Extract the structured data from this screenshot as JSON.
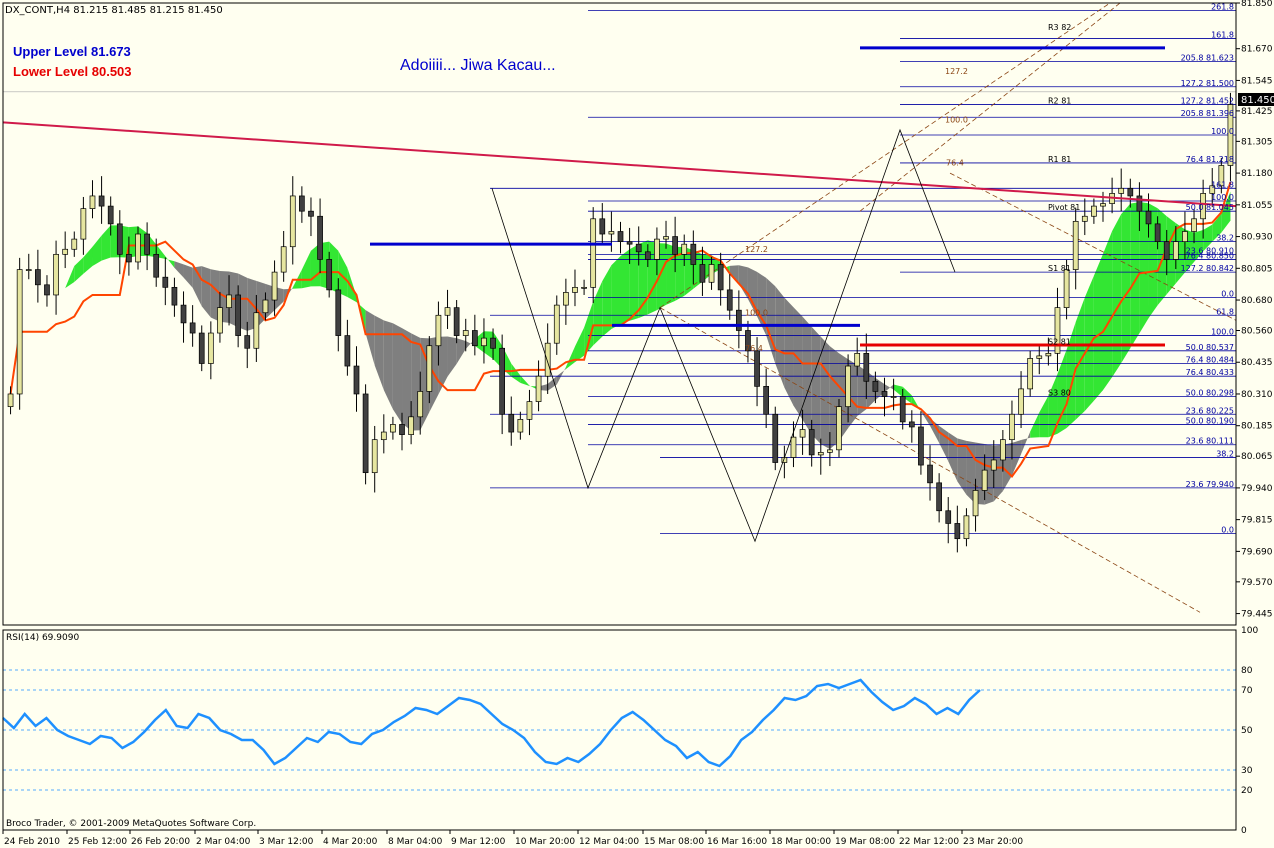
{
  "window": {
    "header": "DX_CONT,H4  81.215 81.485 81.215 81.450",
    "upper_level": "Upper Level 81.673",
    "lower_level": "Lower Level 80.503",
    "annotation": "Adoiiii... Jiwa Kacau...",
    "current_price": "81.450",
    "copyright": "Broco Trader, © 2001-2009 MetaQuotes Software Corp."
  },
  "colors": {
    "background": "#fffff0",
    "grid": "#7f7f7f",
    "bull_candle": "#e6e6a0",
    "bear_candle": "#404040",
    "cloud_bull": "#33e633",
    "cloud_bear": "#7f7f7f",
    "kijun": "#ff4500",
    "trendline": "#d01a4a",
    "fib_lines": "#0000a0",
    "channel": "#8b4513",
    "rsi_line": "#1e90ff",
    "level_blue": "#0000cd",
    "level_red": "#e60000"
  },
  "chart_data": [
    {
      "type": "candlestick",
      "title": "DX_CONT,H4  81.215 81.485 81.215 81.450",
      "ylim": [
        79.4,
        81.85
      ],
      "y_ticks": [
        "81.850",
        "81.670",
        "81.545",
        "81.425",
        "81.305",
        "81.180",
        "81.055",
        "80.930",
        "80.805",
        "80.680",
        "80.560",
        "80.435",
        "80.310",
        "80.185",
        "80.065",
        "79.940",
        "79.815",
        "79.690",
        "79.570",
        "79.445"
      ],
      "x_ticks": [
        "24 Feb 2010",
        "25 Feb 12:00",
        "26 Feb 20:00",
        "2 Mar 04:00",
        "3 Mar 12:00",
        "4 Mar 20:00",
        "8 Mar 04:00",
        "9 Mar 12:00",
        "10 Mar 20:00",
        "12 Mar 04:00",
        "15 Mar 08:00",
        "16 Mar 16:00",
        "18 Mar 00:00",
        "19 Mar 08:00",
        "22 Mar 12:00",
        "23 Mar 20:00"
      ],
      "close": [
        80.31,
        80.8,
        80.8,
        80.74,
        80.7,
        80.86,
        80.88,
        80.92,
        81.04,
        81.09,
        81.05,
        80.98,
        80.86,
        80.83,
        80.94,
        80.86,
        80.77,
        80.73,
        80.66,
        80.59,
        80.55,
        80.43,
        80.55,
        80.65,
        80.7,
        80.54,
        80.49,
        80.63,
        80.68,
        80.79,
        80.89,
        81.09,
        81.03,
        81.01,
        80.84,
        80.72,
        80.54,
        80.42,
        80.31,
        80.0,
        80.13,
        80.16,
        80.19,
        80.15,
        80.22,
        80.32,
        80.5,
        80.62,
        80.65,
        80.54,
        80.56,
        80.5,
        80.53,
        80.49,
        80.23,
        80.16,
        80.21,
        80.28,
        80.38,
        80.51,
        80.66,
        80.71,
        80.73,
        80.73,
        81.0,
        80.94,
        80.95,
        80.91,
        80.9,
        80.87,
        80.84,
        80.92,
        80.93,
        80.86,
        80.9,
        80.82,
        80.75,
        80.82,
        80.72,
        80.64,
        80.56,
        80.48,
        80.34,
        80.23,
        80.04,
        80.06,
        80.14,
        80.17,
        80.07,
        80.08,
        80.09,
        80.26,
        80.42,
        80.47,
        80.36,
        80.32,
        80.3,
        80.3,
        80.2,
        80.18,
        80.03,
        79.96,
        79.85,
        79.8,
        79.74,
        79.83,
        79.93,
        80.01,
        80.05,
        80.13,
        80.23,
        80.33,
        80.45,
        80.46,
        80.47,
        80.65,
        80.8,
        80.99,
        81.01,
        81.05,
        81.06,
        81.1,
        81.12,
        81.09,
        81.03,
        80.98,
        80.91,
        80.84,
        80.91,
        80.95,
        81.0,
        81.1,
        81.13,
        81.21,
        81.45
      ],
      "ichimoku_cloud": "green span shading with grey bear segments",
      "rsi": {
        "title": "RSI(14) 69.9090",
        "ylim": [
          0,
          100
        ],
        "levels": [
          20,
          30,
          50,
          70,
          80
        ],
        "ticks": [
          "100",
          "80",
          "70",
          "50",
          "30",
          "20",
          "0"
        ],
        "values": [
          56,
          51,
          58,
          52,
          56,
          50,
          47,
          45,
          43,
          47,
          46,
          41,
          44,
          49,
          55,
          60,
          52,
          51,
          58,
          56,
          50,
          48,
          45,
          45,
          40,
          33,
          36,
          41,
          46,
          44,
          49,
          48,
          44,
          43,
          48,
          50,
          54,
          57,
          61,
          60,
          58,
          62,
          66,
          65,
          63,
          58,
          53,
          50,
          46,
          39,
          34,
          33,
          36,
          34,
          38,
          43,
          50,
          56,
          59,
          55,
          50,
          45,
          42,
          36,
          39,
          34,
          32,
          37,
          45,
          49,
          55,
          60,
          66,
          65,
          67,
          72,
          73,
          71,
          73,
          75,
          69,
          64,
          60,
          62,
          66,
          63,
          58,
          61,
          58,
          65,
          70
        ],
        "value_label": "69.9090"
      },
      "pivot_labels": [
        "R3 82",
        "R2 81",
        "R1 81",
        "Pivot 81",
        "S1 81",
        "S2 81",
        "S3 80"
      ],
      "fib_labels": [
        "261.8",
        "161.8",
        "205.8 81.623",
        "127.2 81.500",
        "127.2 81.452",
        "205.8 81.396",
        "100.0",
        "76.4 81.218",
        "161.8",
        "100.0",
        "50.0 81.045",
        "38.2",
        "23.6 80.910",
        "76.4 80.850",
        "127.2 80.842",
        "0.0",
        "61.8",
        "100.0",
        "50.0 80.537",
        "76.4 80.484",
        "76.4 80.433",
        "50.0 80.298",
        "23.6 80.225",
        "50.0 80.190",
        "23.6 80.111",
        "38.2",
        "23.6 79.940",
        "0.0"
      ],
      "chart_text": [
        "127.2",
        "100.0",
        "76.4",
        "127.2",
        "100.0",
        "76.4"
      ]
    }
  ]
}
